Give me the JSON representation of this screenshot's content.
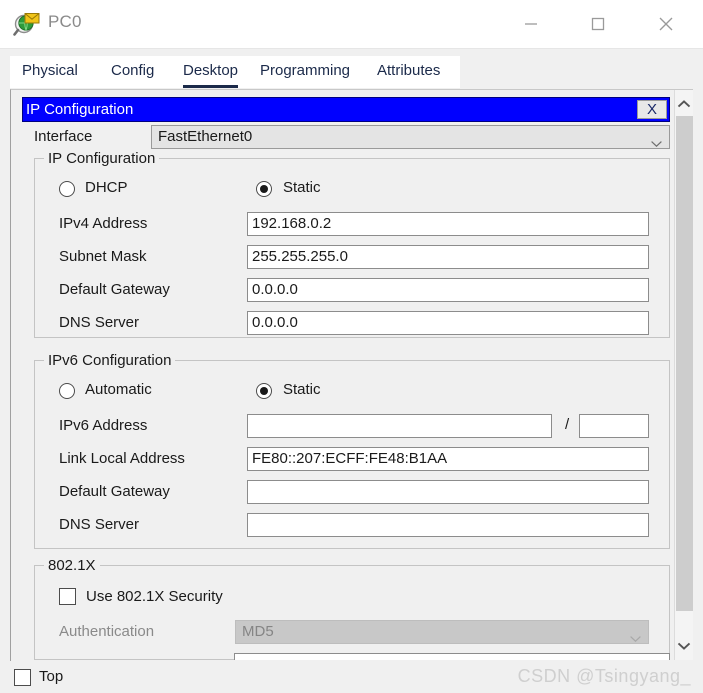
{
  "window": {
    "title": "PC0",
    "icon": "packet-tracer-pc-icon",
    "controls": {
      "minimize": "—",
      "maximize": "□",
      "close": "✕"
    }
  },
  "tabs": [
    {
      "label": "Physical",
      "active": false
    },
    {
      "label": "Config",
      "active": false
    },
    {
      "label": "Desktop",
      "active": true
    },
    {
      "label": "Programming",
      "active": false
    },
    {
      "label": "Attributes",
      "active": false
    }
  ],
  "dialog": {
    "caption": "IP Configuration",
    "close_label": "X"
  },
  "interface": {
    "label": "Interface",
    "value": "FastEthernet0"
  },
  "ipv4": {
    "group_title": "IP Configuration",
    "mode_dhcp": {
      "label": "DHCP",
      "selected": false
    },
    "mode_static": {
      "label": "Static",
      "selected": true
    },
    "fields": [
      {
        "label": "IPv4 Address",
        "value": "192.168.0.2"
      },
      {
        "label": "Subnet Mask",
        "value": "255.255.255.0"
      },
      {
        "label": "Default Gateway",
        "value": "0.0.0.0"
      },
      {
        "label": "DNS Server",
        "value": "0.0.0.0"
      }
    ]
  },
  "ipv6": {
    "group_title": "IPv6 Configuration",
    "mode_automatic": {
      "label": "Automatic",
      "selected": false
    },
    "mode_static": {
      "label": "Static",
      "selected": true
    },
    "address_label": "IPv6 Address",
    "address_value": "",
    "prefix_separator": "/",
    "prefix_value": "",
    "fields": [
      {
        "label": "Link Local Address",
        "value": "FE80::207:ECFF:FE48:B1AA"
      },
      {
        "label": "Default Gateway",
        "value": ""
      },
      {
        "label": "DNS Server",
        "value": ""
      }
    ]
  },
  "dot1x": {
    "group_title": "802.1X",
    "use_security": {
      "label": "Use 802.1X Security",
      "checked": false
    },
    "authentication": {
      "label": "Authentication",
      "value": "MD5",
      "disabled": true
    }
  },
  "footer": {
    "top_checkbox": {
      "label": "Top",
      "checked": false
    },
    "watermark": "CSDN @Tsingyang_"
  },
  "scrollbar": {
    "up_icon": "chevron-up-icon",
    "down_icon": "chevron-down-icon"
  },
  "colors": {
    "dialog_caption_bg": "#0000ff",
    "tab_text": "#1b2a4a",
    "window_bg": "#f0f0f0",
    "field_bg": "#ffffff",
    "disabled_bg": "#c8c8c8"
  }
}
